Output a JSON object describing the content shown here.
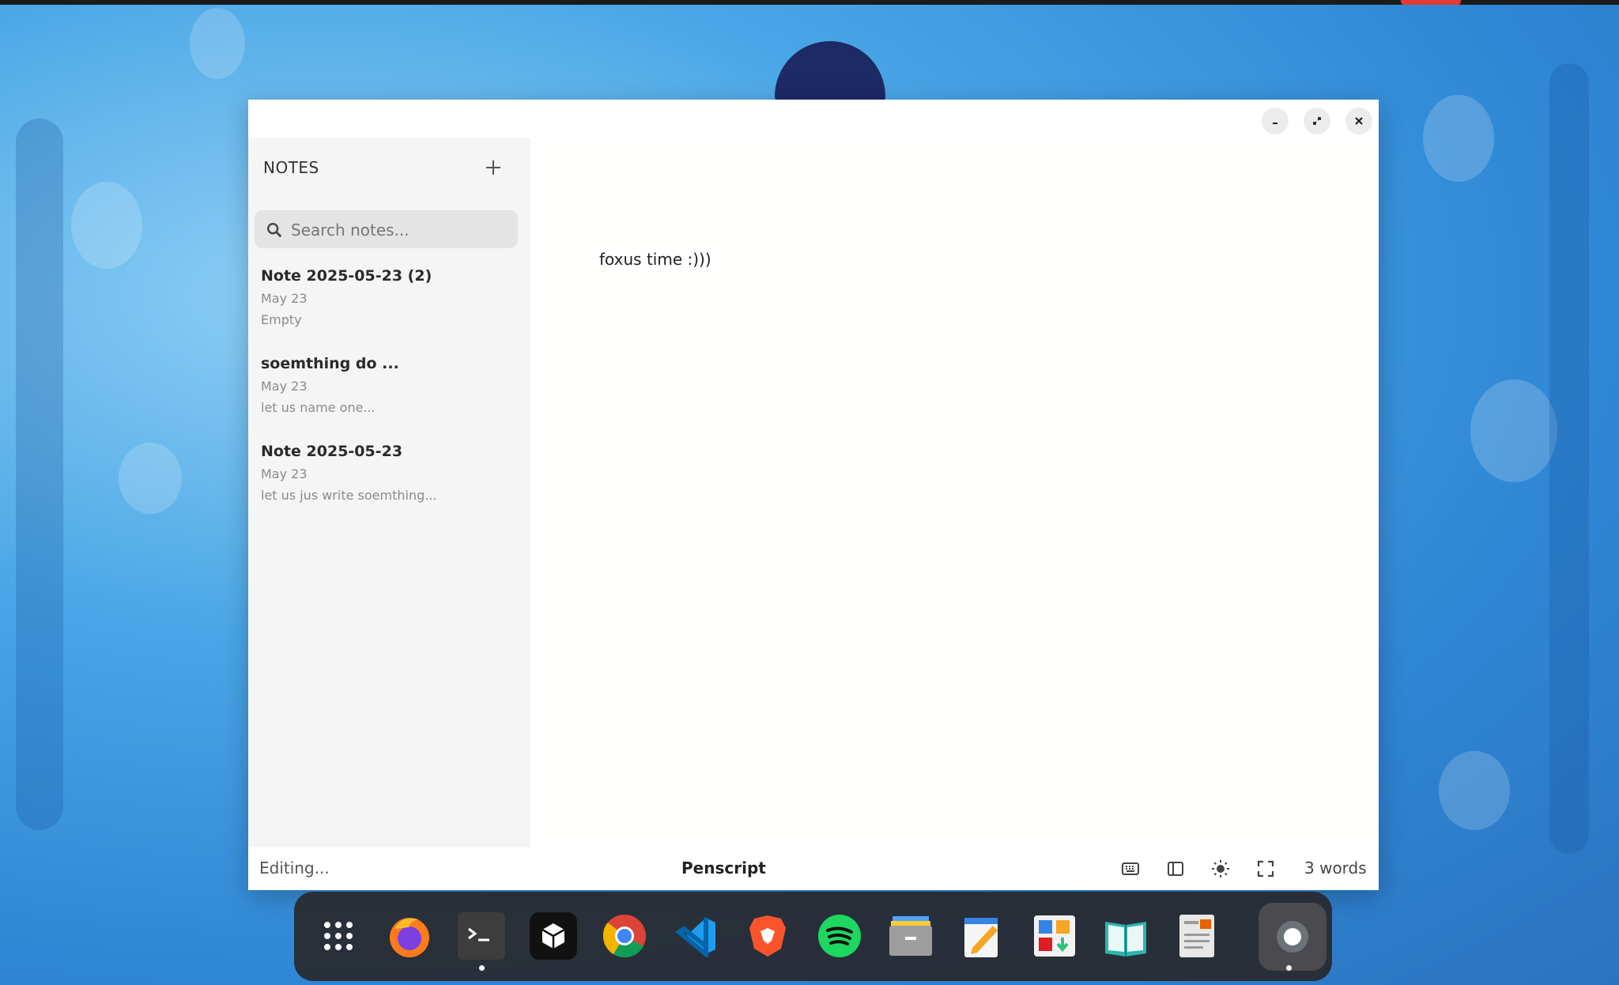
{
  "sidebar": {
    "title": "NOTES",
    "search_placeholder": "Search notes...",
    "notes": [
      {
        "title": "Note 2025-05-23 (2)",
        "date": "May 23",
        "preview": "Empty"
      },
      {
        "title": "soemthing do ...",
        "date": "May 23",
        "preview": "let us name one..."
      },
      {
        "title": "Note 2025-05-23",
        "date": "May 23",
        "preview": "let us jus write soemthing..."
      }
    ]
  },
  "editor": {
    "content": "foxus time :)))"
  },
  "statusbar": {
    "mode": "Editing...",
    "app_name": "Penscript",
    "word_count": "3 words"
  },
  "dock": {
    "apps": [
      "apps-grid-icon",
      "firefox-icon",
      "terminal-icon",
      "cube-app-icon",
      "chrome-icon",
      "vscode-icon",
      "brave-icon",
      "spotify-icon",
      "files-icon",
      "text-editor-icon",
      "software-center-icon",
      "reader-icon",
      "document-viewer-icon",
      "settings-icon"
    ]
  },
  "colors": {
    "accent_search_bg": "#e4e4e4",
    "sidebar_bg": "#f5f5f5",
    "dock_bg": "#28282c"
  }
}
